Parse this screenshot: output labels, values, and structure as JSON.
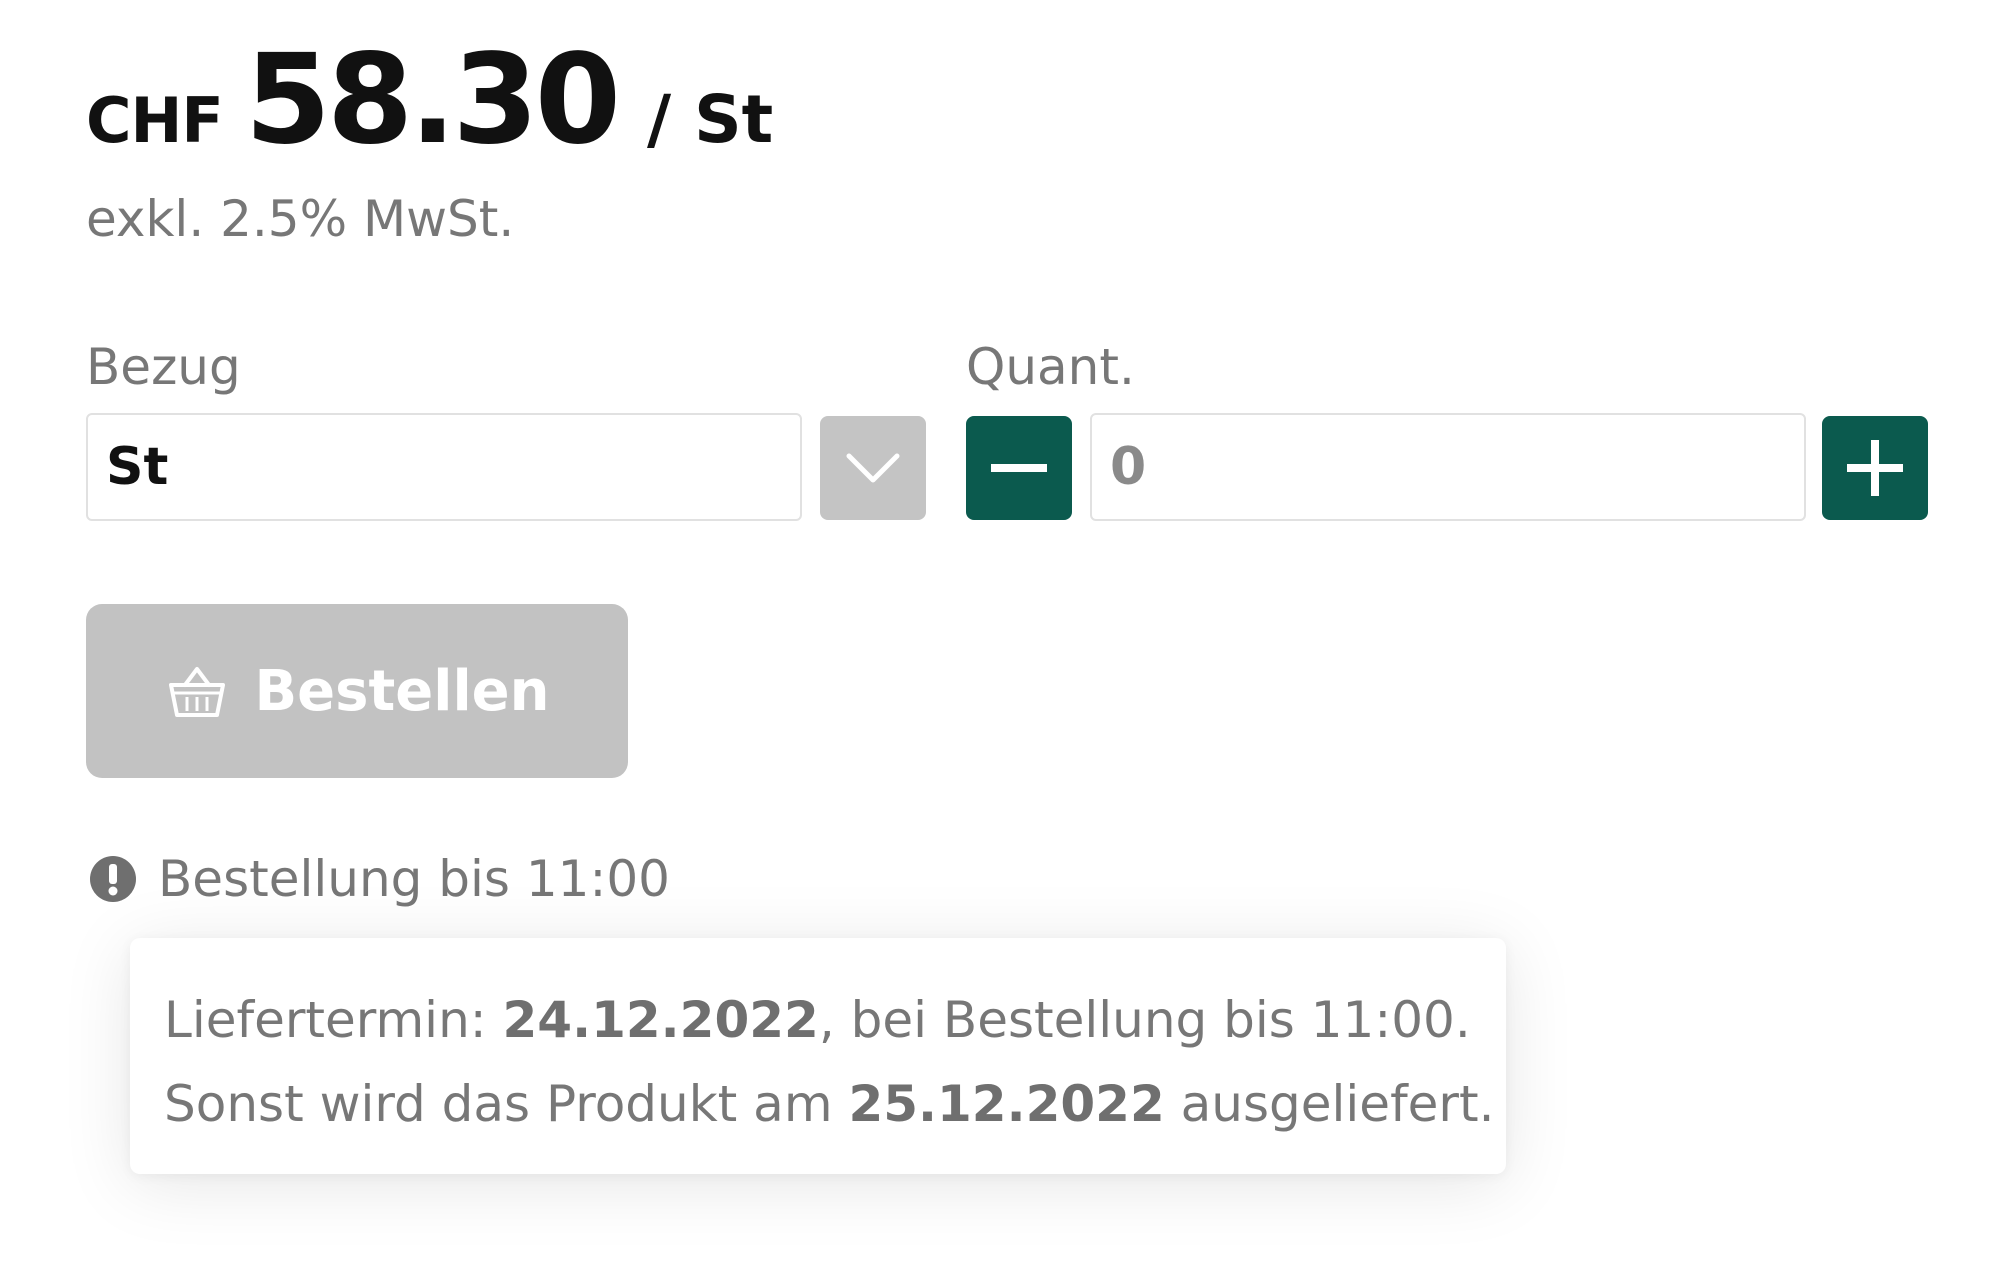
{
  "price": {
    "currency": "CHF",
    "amount": "58.30",
    "unit": "/ St"
  },
  "vat_note": "exkl. 2.5% MwSt.",
  "bezug": {
    "label": "Bezug",
    "selected_value": "St",
    "dropdown_icon": "chevron-down-icon"
  },
  "quantity": {
    "label": "Quant.",
    "value": "0",
    "decrement_icon": "minus-icon",
    "increment_icon": "plus-icon"
  },
  "order_button": {
    "label": "Bestellen",
    "icon": "basket-icon"
  },
  "deadline": {
    "icon": "alert-icon",
    "text": "Bestellung bis 11:00"
  },
  "tooltip": {
    "line1_prefix": "Liefertermin: ",
    "line1_date": "24.12.2022",
    "line1_suffix": ", bei Bestellung bis 11:00.",
    "line2_prefix": "Sonst wird das Produkt am ",
    "line2_date": "25.12.2022",
    "line2_suffix": " ausgeliefert."
  },
  "colors": {
    "accent_green": "#0b5a4e",
    "disabled_gray": "#c2c2c2",
    "muted_text": "#777777"
  }
}
